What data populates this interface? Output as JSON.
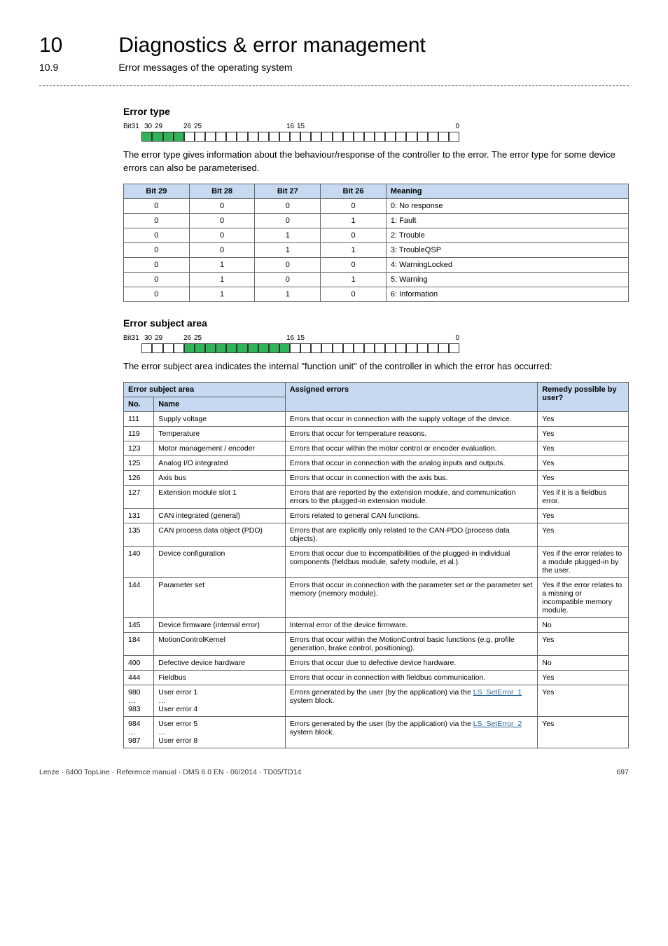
{
  "header": {
    "chapter_num": "10",
    "chapter_title": "Diagnostics & error management",
    "section_num": "10.9",
    "section_title": "Error messages of the operating system"
  },
  "error_type": {
    "heading": "Error type",
    "bit_labels": {
      "l_bit31": "Bit31",
      "l_30": "30",
      "l_29_left": "29",
      "l_26": "26",
      "l_25": "25",
      "l_16": "16",
      "l_15": "15",
      "l_0": "0"
    },
    "description": "The error type gives information about the behaviour/response of the controller to the error. The error type for some device errors can also be parameterised.",
    "table": {
      "headers": {
        "b29": "Bit 29",
        "b28": "Bit 28",
        "b27": "Bit 27",
        "b26": "Bit 26",
        "meaning": "Meaning"
      },
      "rows": [
        {
          "b29": "0",
          "b28": "0",
          "b27": "0",
          "b26": "0",
          "meaning": "0: No response"
        },
        {
          "b29": "0",
          "b28": "0",
          "b27": "0",
          "b26": "1",
          "meaning": "1: Fault"
        },
        {
          "b29": "0",
          "b28": "0",
          "b27": "1",
          "b26": "0",
          "meaning": "2: Trouble"
        },
        {
          "b29": "0",
          "b28": "0",
          "b27": "1",
          "b26": "1",
          "meaning": "3: TroubleQSP"
        },
        {
          "b29": "0",
          "b28": "1",
          "b27": "0",
          "b26": "0",
          "meaning": "4: WarningLocked"
        },
        {
          "b29": "0",
          "b28": "1",
          "b27": "0",
          "b26": "1",
          "meaning": "5: Warning"
        },
        {
          "b29": "0",
          "b28": "1",
          "b27": "1",
          "b26": "0",
          "meaning": "6: Information"
        }
      ]
    }
  },
  "chart_data": {
    "type": "table",
    "title": "Error type bits and meaning",
    "columns": [
      "Bit 29",
      "Bit 28",
      "Bit 27",
      "Bit 26",
      "Meaning"
    ],
    "rows": [
      [
        0,
        0,
        0,
        0,
        "0: No response"
      ],
      [
        0,
        0,
        0,
        1,
        "1: Fault"
      ],
      [
        0,
        0,
        1,
        0,
        "2: Trouble"
      ],
      [
        0,
        0,
        1,
        1,
        "3: TroubleQSP"
      ],
      [
        0,
        1,
        0,
        0,
        "4: WarningLocked"
      ],
      [
        0,
        1,
        0,
        1,
        "5: Warning"
      ],
      [
        0,
        1,
        1,
        0,
        "6: Information"
      ]
    ]
  },
  "error_subject": {
    "heading": "Error subject area",
    "bit_labels": {
      "l_bit31": "Bit31",
      "l_30": "30",
      "l_29_left": "29",
      "l_26": "26",
      "l_25": "25",
      "l_16": "16",
      "l_15": "15",
      "l_0": "0"
    },
    "description": "The error subject area indicates the internal \"function unit\" of the controller in which the error has occurred:",
    "table": {
      "headers": {
        "subj": "Error subject area",
        "no": "No.",
        "name": "Name",
        "assigned": "Assigned errors",
        "remedy": "Remedy possible by user?"
      },
      "rows": [
        {
          "no": "111",
          "name": "Supply voltage",
          "assigned": "Errors that occur in connection with the supply voltage of the device.",
          "remedy": "Yes"
        },
        {
          "no": "119",
          "name": "Temperature",
          "assigned": "Errors that occur for temperature reasons.",
          "remedy": "Yes"
        },
        {
          "no": "123",
          "name": "Motor management / encoder",
          "assigned": "Errors that occur within the motor control or encoder evaluation.",
          "remedy": "Yes"
        },
        {
          "no": "125",
          "name": "Analog I/O integrated",
          "assigned": "Errors that occur in connection with the analog inputs and outputs.",
          "remedy": "Yes"
        },
        {
          "no": "126",
          "name": "Axis bus",
          "assigned": "Errors that occur in connection with the axis bus.",
          "remedy": "Yes"
        },
        {
          "no": "127",
          "name": "Extension module slot 1",
          "assigned": "Errors that are reported by the extension module, and communication errors to the plugged-in extension module.",
          "remedy": "Yes if it is a fieldbus error."
        },
        {
          "no": "131",
          "name": "CAN integrated (general)",
          "assigned": "Errors related to general CAN functions.",
          "remedy": "Yes"
        },
        {
          "no": "135",
          "name": "CAN process data object (PDO)",
          "assigned": "Errors that are explicitly only related to the CAN-PDO (process data objects).",
          "remedy": "Yes"
        },
        {
          "no": "140",
          "name": "Device configuration",
          "assigned": "Errors that occur due to incompatibilities of the plugged-in individual components (fieldbus module, safety module, et al.).",
          "remedy": "Yes if the error relates to a module plugged-in by the user."
        },
        {
          "no": "144",
          "name": "Parameter set",
          "assigned": "Errors that occur in connection with the parameter set or the parameter set memory (memory module).",
          "remedy": "Yes if the error relates to a missing or incompatible memory module."
        },
        {
          "no": "145",
          "name": "Device firmware (internal error)",
          "assigned": "Internal error of the device firmware.",
          "remedy": "No"
        },
        {
          "no": "184",
          "name": "MotionControlKernel",
          "assigned": "Errors that occur within the MotionControl basic functions (e.g. profile generation, brake control, positioning).",
          "remedy": "Yes"
        },
        {
          "no": "400",
          "name": "Defective device hardware",
          "assigned": "Errors that occur due to defective device hardware.",
          "remedy": "No"
        },
        {
          "no": "444",
          "name": "Fieldbus",
          "assigned": "Errors that occur in connection with fieldbus communication.",
          "remedy": "Yes"
        },
        {
          "no": "980\n…\n983",
          "name": "User error 1\n…\nUser error 4",
          "assigned_prefix": "Errors generated by the user (by the application) via the ",
          "link": "LS_SetError_1",
          "assigned_suffix": " system block.",
          "remedy": "Yes"
        },
        {
          "no": "984\n…\n987",
          "name": "User error 5\n…\nUser error 8",
          "assigned_prefix": "Errors generated by the user (by the application) via the ",
          "link": "LS_SetError_2",
          "assigned_suffix": " system block.",
          "remedy": "Yes"
        }
      ]
    }
  },
  "footer": {
    "left": "Lenze · 8400 TopLine · Reference manual · DMS 6.0 EN · 06/2014 · TD05/TD14",
    "right": "697"
  }
}
